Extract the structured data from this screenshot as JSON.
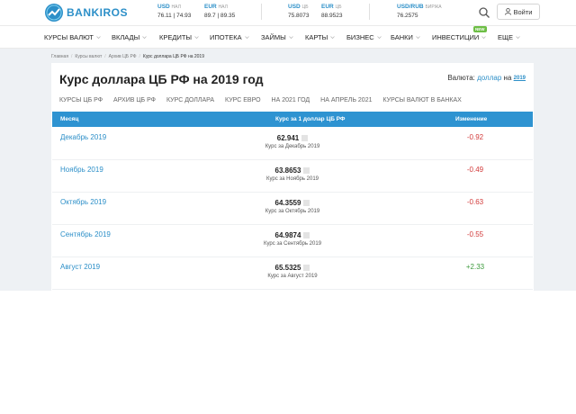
{
  "brand": {
    "name": "BANKIROS"
  },
  "header_rates": [
    {
      "currency": "USD",
      "kind": "НАЛ",
      "value": "76.11 | 74.93"
    },
    {
      "currency": "EUR",
      "kind": "НАЛ",
      "value": "89.7 | 89.35"
    },
    {
      "currency": "USD",
      "kind": "ЦБ",
      "value": "75.8073"
    },
    {
      "currency": "EUR",
      "kind": "ЦБ",
      "value": "88.9523"
    },
    {
      "currency": "USD/RUB",
      "kind": "БИРЖА",
      "value": "76.2575"
    }
  ],
  "header": {
    "login_label": "Войти"
  },
  "nav": {
    "items": [
      "КУРСЫ ВАЛЮТ",
      "ВКЛАДЫ",
      "КРЕДИТЫ",
      "ИПОТЕКА",
      "ЗАЙМЫ",
      "КАРТЫ",
      "БИЗНЕС",
      "БАНКИ",
      "ИНВЕСТИЦИИ",
      "ЕЩЕ"
    ],
    "new_badge": "NEW"
  },
  "breadcrumb": [
    "Главная",
    "Курсы валют",
    "Архив ЦБ РФ",
    "Курс доллара ЦБ РФ на 2019"
  ],
  "page": {
    "title": "Курс доллара ЦБ РФ на 2019 год",
    "currency_prefix": "Валюта:",
    "currency_link": "доллар",
    "currency_mid": "на",
    "year": "2019"
  },
  "tabs": [
    "КУРСЫ ЦБ РФ",
    "АРХИВ ЦБ РФ",
    "КУРС ДОЛЛАРА",
    "КУРС ЕВРО",
    "НА 2021 ГОД",
    "НА АПРЕЛЬ 2021",
    "КУРСЫ ВАЛЮТ В БАНКАХ"
  ],
  "table": {
    "headers": {
      "month": "Месяц",
      "rate": "Курс за 1 доллар ЦБ РФ",
      "change": "Изменение"
    },
    "rows": [
      {
        "month": "Декабрь 2019",
        "value": "62.941",
        "sub": "Курс за Декабрь 2019",
        "change": "-0.92"
      },
      {
        "month": "Ноябрь 2019",
        "value": "63.8653",
        "sub": "Курс за Ноябрь 2019",
        "change": "-0.49"
      },
      {
        "month": "Октябрь 2019",
        "value": "64.3559",
        "sub": "Курс за Октябрь 2019",
        "change": "-0.63"
      },
      {
        "month": "Сентябрь 2019",
        "value": "64.9874",
        "sub": "Курс за Сентябрь 2019",
        "change": "-0.55"
      },
      {
        "month": "Август 2019",
        "value": "65.5325",
        "sub": "Курс за Август 2019",
        "change": "+2.33"
      }
    ]
  },
  "colors": {
    "brand": "#2c8fc8",
    "header_blue": "#2e93d1",
    "negative": "#d23a3a",
    "positive": "#3c9a3c"
  }
}
